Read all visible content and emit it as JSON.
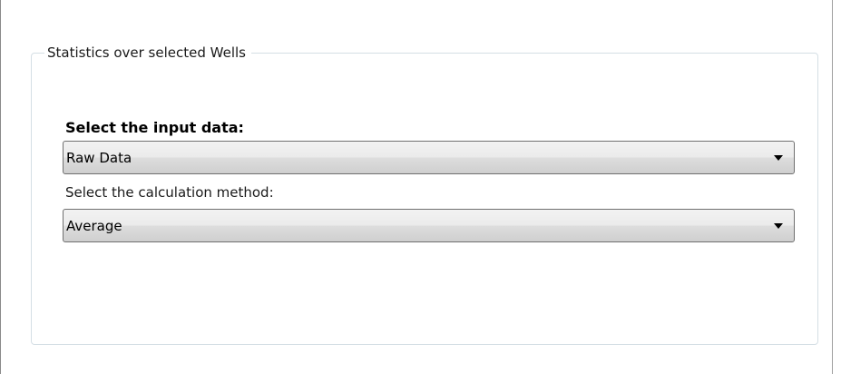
{
  "group": {
    "title": "Statistics over selected Wells"
  },
  "input_data": {
    "label": "Select the input data:",
    "selected": "Raw Data",
    "arrow_icon": "chevron-down-icon"
  },
  "calc_method": {
    "label": "Select the calculation method:",
    "selected": "Average",
    "arrow_icon": "chevron-down-icon"
  }
}
